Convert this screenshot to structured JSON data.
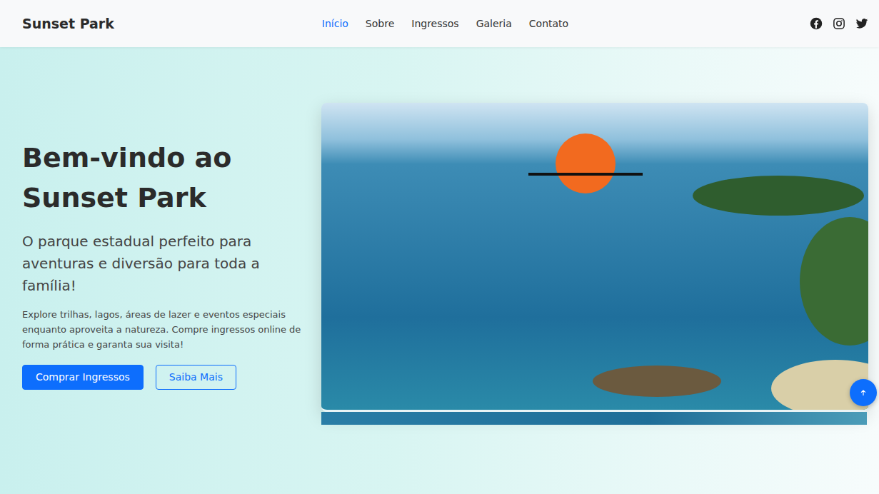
{
  "header": {
    "brand": "Sunset Park",
    "nav": [
      {
        "label": "Início",
        "selected": true
      },
      {
        "label": "Sobre",
        "selected": false
      },
      {
        "label": "Ingressos",
        "selected": false
      },
      {
        "label": "Galeria",
        "selected": false
      },
      {
        "label": "Contato",
        "selected": false
      }
    ]
  },
  "hero": {
    "title": "Bem-vindo ao Sunset Park",
    "subtitle": "O parque estadual perfeito para aventuras e diversão para toda a família!",
    "text": "Explore trilhas, lagos, áreas de lazer e eventos especiais enquanto aproveita a natureza. Compre ingressos online de forma prática e garanta sua visita!",
    "buttons": [
      {
        "label": "Comprar Ingressos",
        "kind": "primary"
      },
      {
        "label": "Saiba Mais",
        "kind": "outline"
      }
    ]
  }
}
